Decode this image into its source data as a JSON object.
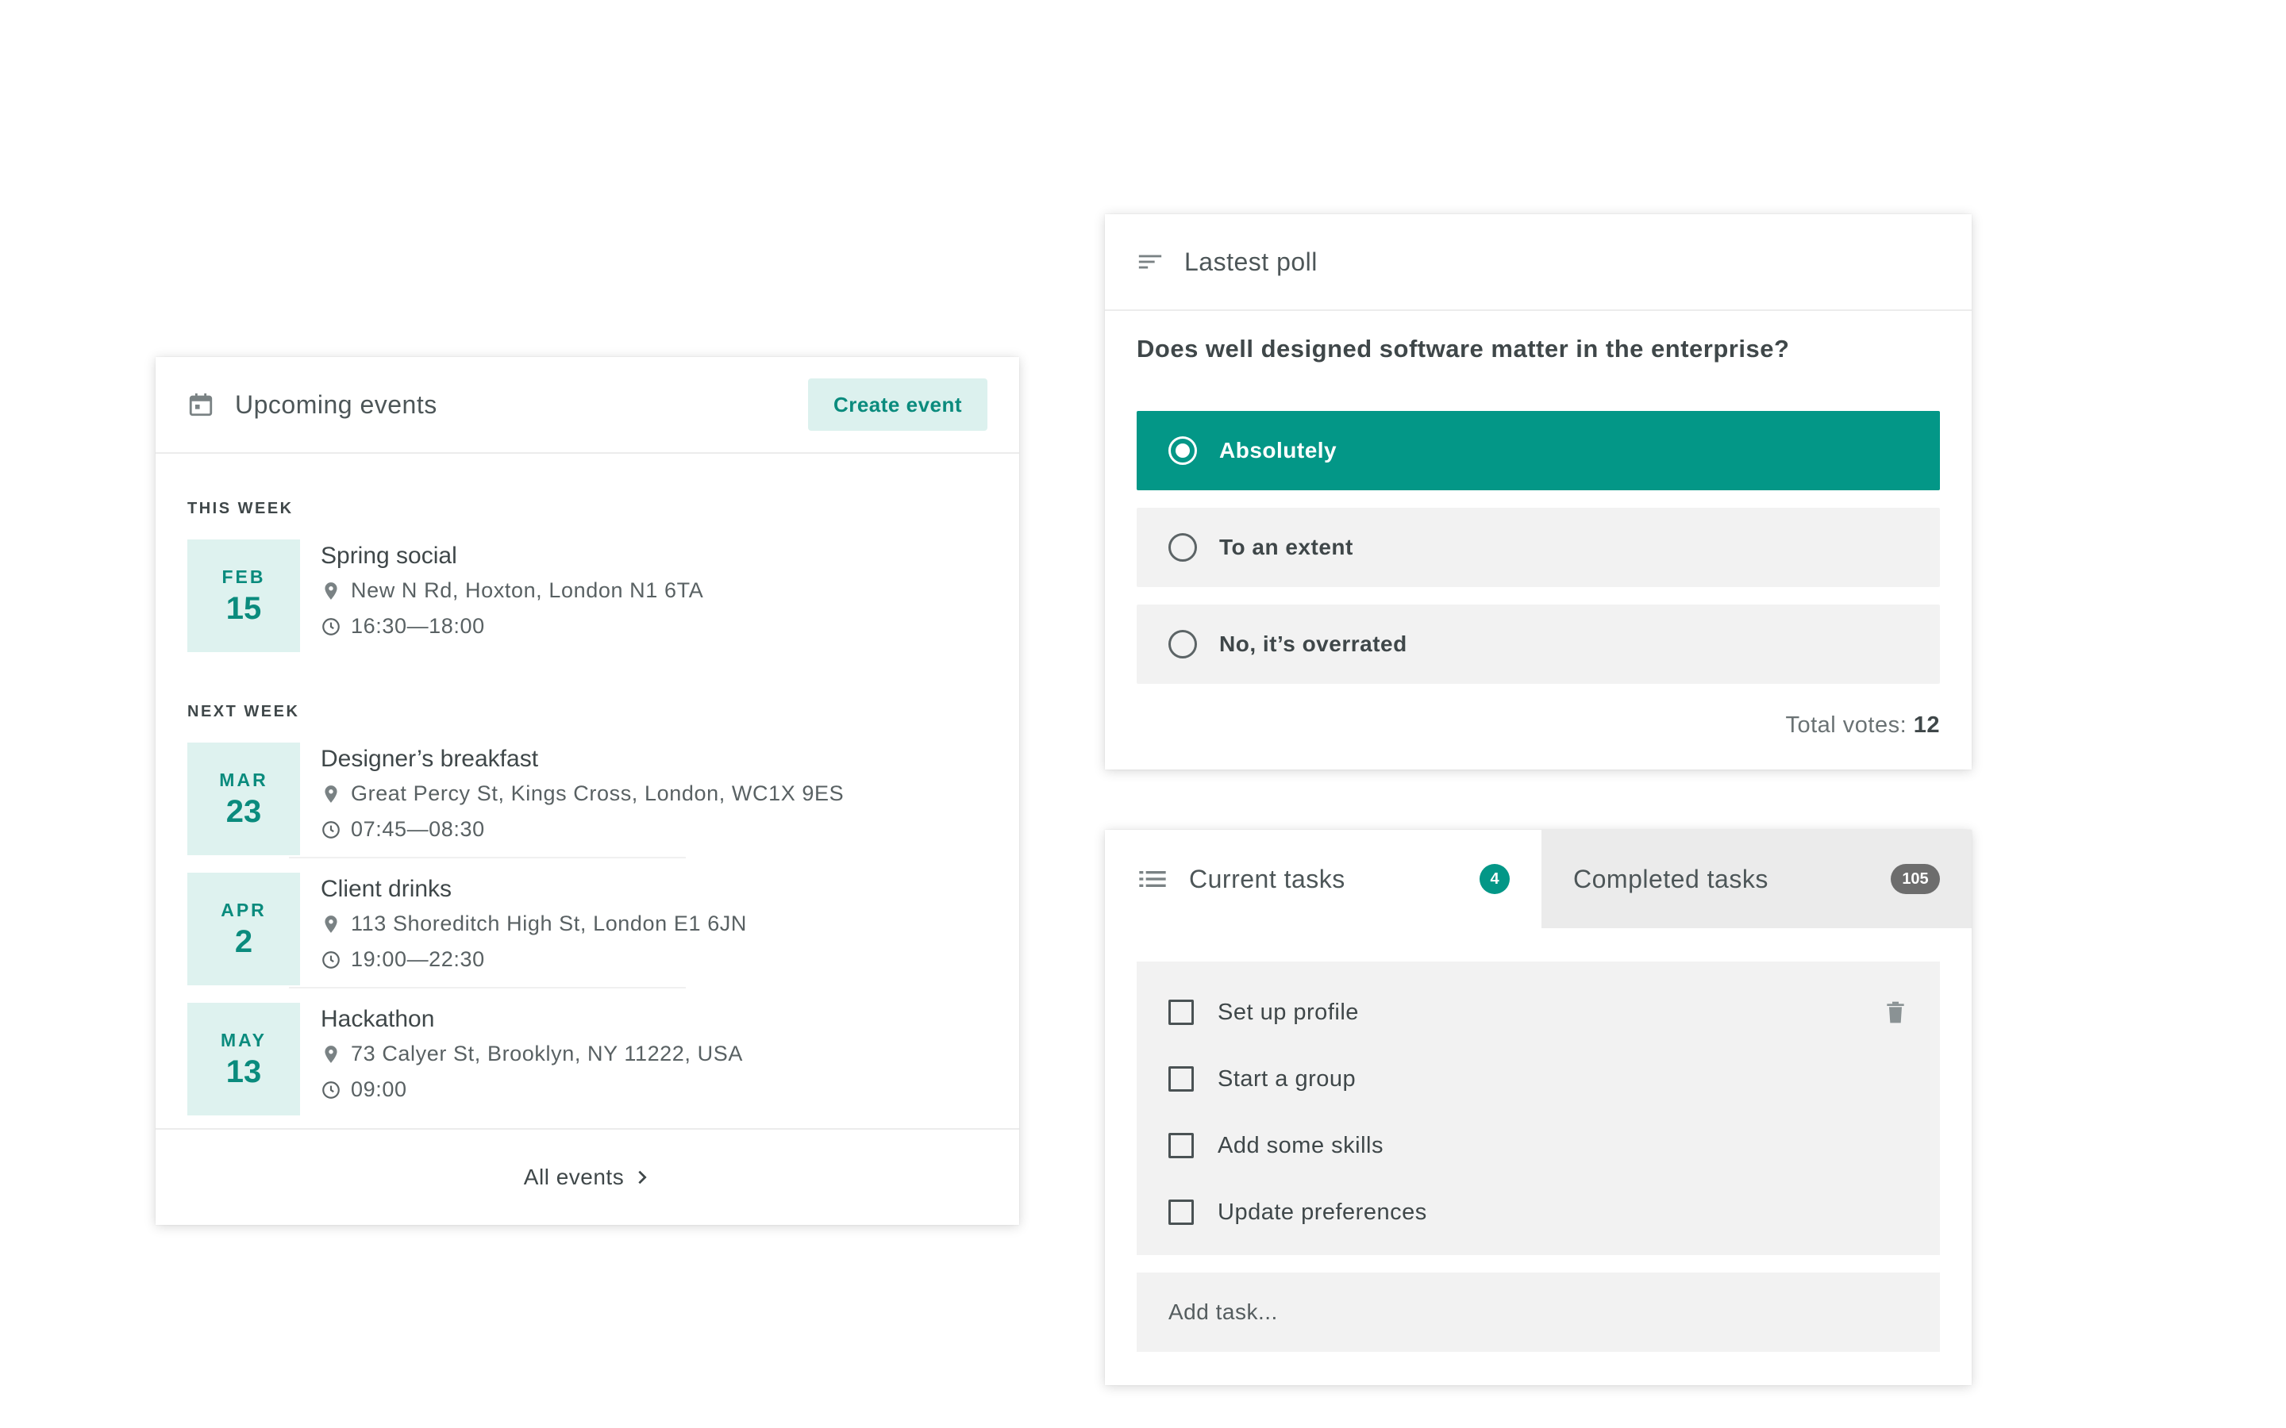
{
  "events": {
    "title": "Upcoming events",
    "create_label": "Create event",
    "sections": [
      {
        "label": "THIS WEEK"
      },
      {
        "label": "NEXT WEEK"
      }
    ],
    "items": [
      {
        "month": "FEB",
        "day": "15",
        "title": "Spring social",
        "location": "New N Rd, Hoxton, London N1 6TA",
        "time": "16:30—18:00"
      },
      {
        "month": "MAR",
        "day": "23",
        "title": "Designer’s breakfast",
        "location": "Great Percy St, Kings Cross, London, WC1X 9ES",
        "time": "07:45—08:30"
      },
      {
        "month": "APR",
        "day": "2",
        "title": "Client drinks",
        "location": "113 Shoreditch High St, London E1 6JN",
        "time": "19:00—22:30"
      },
      {
        "month": "MAY",
        "day": "13",
        "title": "Hackathon",
        "location": "73 Calyer St, Brooklyn, NY 11222, USA",
        "time": "09:00"
      }
    ],
    "footer_label": "All events"
  },
  "poll": {
    "title": "Lastest poll",
    "question": "Does well designed software matter in the enterprise?",
    "options": [
      {
        "label": "Absolutely",
        "selected": true
      },
      {
        "label": "To an extent",
        "selected": false
      },
      {
        "label": "No, it’s overrated",
        "selected": false
      }
    ],
    "total_label": "Total votes:",
    "total_value": "12"
  },
  "tasks": {
    "tabs": [
      {
        "label": "Current tasks",
        "count": "4",
        "active": true
      },
      {
        "label": "Completed tasks",
        "count": "105",
        "active": false
      }
    ],
    "items": [
      {
        "label": "Set up profile"
      },
      {
        "label": "Start a group"
      },
      {
        "label": "Add some skills"
      },
      {
        "label": "Update preferences"
      }
    ],
    "add_placeholder": "Add task..."
  },
  "colors": {
    "accent": "#039787",
    "accent_light": "#def2ef",
    "panel_grey": "#f2f2f2"
  },
  "icons": {
    "events_header": "calendar-icon",
    "poll_header": "sort-lines-icon",
    "tasks_header": "list-icon",
    "location": "pin-icon",
    "time": "clock-icon",
    "footer": "chevron-right-icon",
    "task_delete": "trash-icon"
  }
}
